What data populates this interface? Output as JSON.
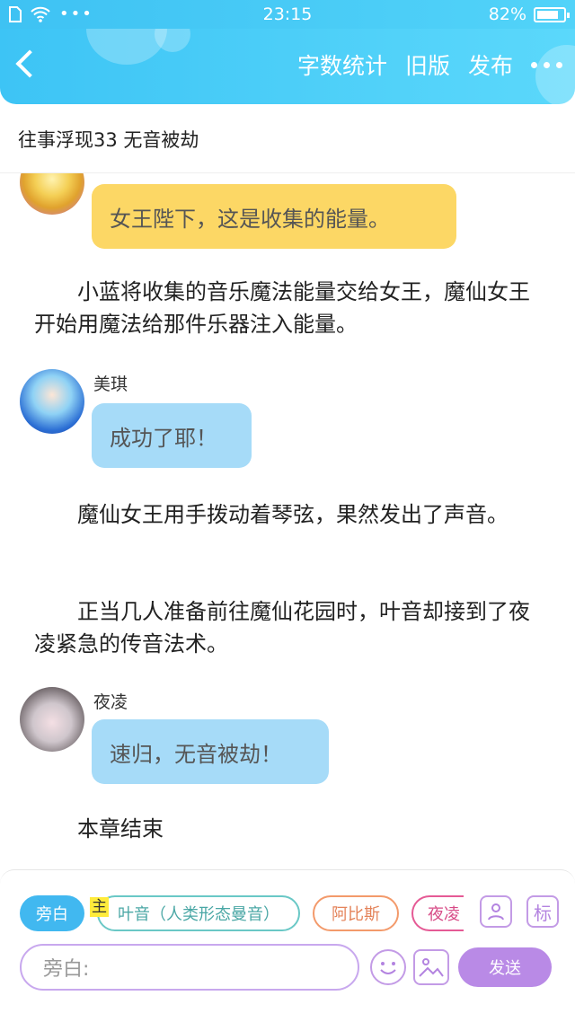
{
  "status_bar": {
    "time": "23:15",
    "battery": "82%",
    "battery_level": 0.82
  },
  "header": {
    "actions": [
      "字数统计",
      "旧版",
      "发布"
    ]
  },
  "chapter_title": "往事浮现33 无音被劫",
  "messages": [
    {
      "type": "bubble",
      "speaker": "",
      "text": "女王陛下，这是收集的能量。",
      "color": "yellow"
    },
    {
      "type": "narration",
      "text": "小蓝将收集的音乐魔法能量交给女王，魔仙女王开始用魔法给那件乐器注入能量。"
    },
    {
      "type": "bubble",
      "speaker": "美琪",
      "text": "成功了耶！",
      "color": "blue"
    },
    {
      "type": "narration",
      "text": "魔仙女王用手拨动着琴弦，果然发出了声音。"
    },
    {
      "type": "narration",
      "text": "正当几人准备前往魔仙花园时，叶音却接到了夜凌紧急的传音法术。"
    },
    {
      "type": "bubble",
      "speaker": "夜凌",
      "text": "速归，无音被劫！",
      "color": "blue"
    },
    {
      "type": "narration",
      "text": "本章结束"
    }
  ],
  "bottom_bar": {
    "roles": [
      "旁白",
      "叶音（人类形态曼音）",
      "阿比斯",
      "夜凌"
    ],
    "main_tag": "主",
    "icon_badge": "标",
    "input_placeholder": "旁白:",
    "send_label": "发送"
  },
  "colors": {
    "accent": "#3ec2f3",
    "yellow_bubble": "#fcd765",
    "blue_bubble": "#a6dbf8",
    "purple": "#b98ae6"
  }
}
